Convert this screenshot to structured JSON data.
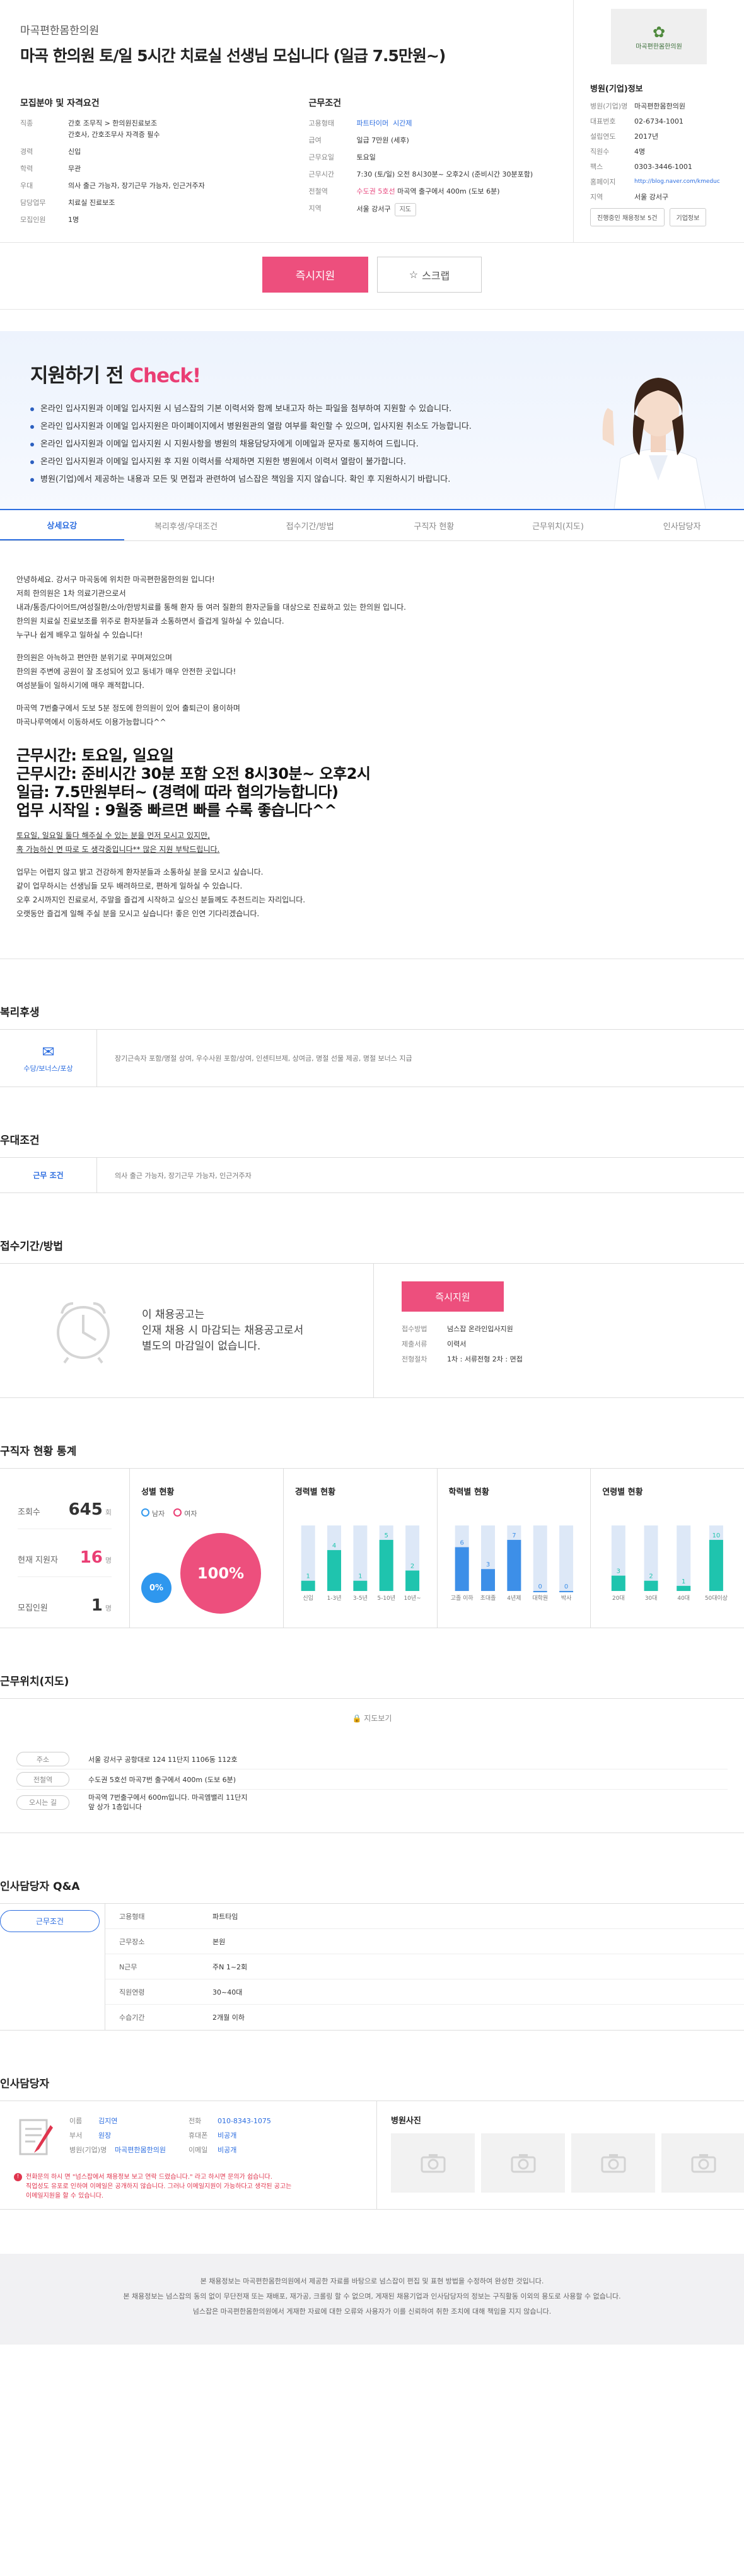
{
  "header": {
    "company": "마곡편한몸한의원",
    "title": "마곡 한의원 토/일 5시간 치료실 선생님 모십니다 (일급 7.5만원~)"
  },
  "recruit_info": {
    "heading": "모집분야 및 자격요건",
    "rows": [
      {
        "k": "직종",
        "v": "간호 조무직 > 한의원진료보조"
      },
      {
        "k": "",
        "v": "간호사, 간호조무사 자격증 필수"
      },
      {
        "k": "경력",
        "v": "신입"
      },
      {
        "k": "학력",
        "v": "무관"
      },
      {
        "k": "우대",
        "v": "의사 출근 가능자, 장기근무 가능자, 인근거주자"
      },
      {
        "k": "담당업무",
        "v": "치료실 진료보조"
      },
      {
        "k": "모집인원",
        "v": "1명"
      }
    ]
  },
  "work_info": {
    "heading": "근무조건",
    "rows": [
      {
        "k": "고용형태",
        "v1": "파트타이머",
        "v2": "시간제"
      },
      {
        "k": "급여",
        "v1": "일급 7만원 (세후)"
      },
      {
        "k": "근무요일",
        "v1": "토요일"
      },
      {
        "k": "근무시간",
        "v1": "7:30 (토/일) 오전 8시30분~ 오후2시 (준비시간 30분포함)"
      },
      {
        "k": "전철역",
        "v1": "수도권 5호선",
        "v2": "마곡역 출구에서 400m (도보 6분)"
      },
      {
        "k": "지역",
        "v1": "서울 강서구",
        "btn": "지도"
      }
    ]
  },
  "hospital": {
    "logo_text": "마곡편한몸한의원",
    "heading": "병원(기업)정보",
    "rows": [
      {
        "k": "병원(기업)명",
        "v": "마곡편한몸한의원"
      },
      {
        "k": "대표번호",
        "v": "02-6734-1001"
      },
      {
        "k": "설립연도",
        "v": "2017년"
      },
      {
        "k": "직원수",
        "v": "4명"
      },
      {
        "k": "팩스",
        "v": "0303-3446-1001"
      },
      {
        "k": "홈페이지",
        "v": "http://blog.naver.com/kmeduc"
      },
      {
        "k": "지역",
        "v": "서울 강서구"
      }
    ],
    "btn_jobs": "진행중인 채용정보 5건",
    "btn_info": "기업정보"
  },
  "actions": {
    "apply": "즉시지원",
    "scrap": "스크랩"
  },
  "check": {
    "title_a": "지원하기 전 ",
    "title_b": "Check!",
    "items": [
      "온라인 입사지원과 이메일 입사지원 시 넘스잡의 기본 이력서와 함께 보내고자 하는 파일을 첨부하여 지원할 수 있습니다.",
      "온라인 입사지원과 이메일 입사지원은 마이페이지에서 병원원관의 열람 여부를 확인할 수 있으며, 입사지원 취소도 가능합니다.",
      "온라인 입사지원과 이메일 입사지원 시 지원사항을 병원의 채용담당자에게 이메일과 문자로 통지하여 드립니다.",
      "온라인 입사지원과 이메일 입사지원 후 지원 이력서를 삭제하면 지원한 병원에서 이력서 열람이 불가합니다.",
      "병원(기업)에서 제공하는 내용과 모든 및 면접과 관련하여 넘스잡은 책임을 지지 않습니다. 확인 후 지원하시기 바랍니다."
    ]
  },
  "tabs": [
    "상세요강",
    "복리후생/우대조건",
    "접수기간/방법",
    "구직자 현황",
    "근무위치(지도)",
    "인사담당자"
  ],
  "detail": {
    "p1": [
      "안녕하세요. 강서구 마곡동에 위치한 마곡편한몸한의원 입니다!",
      "저희 한의원은 1차 의료기관으로서",
      "내과/통증/다이어트/여성질환/소아/한방치료를 통해 환자 등 여러 질환의 환자군들을 대상으로 진료하고 있는 한의원 입니다.",
      "한의원 치료실 진료보조를 위주로 환자분들과 소통하면서 즐겁게 일하실 수 있습니다.",
      "누구나 쉽게 배우고 일하실 수 있습니다!"
    ],
    "p2": [
      "한의원은 아늑하고 편안한 분위기로 꾸며져있으며",
      "한의원 주변에 공원이 잘 조성되어 있고 동네가 매우 안전한 곳입니다!",
      "여성분들이 일하시기에 매우 쾌적합니다."
    ],
    "p3": [
      "마곡역 7번출구에서 도보 5분 정도에 한의원이 있어 출퇴근이 용이하며",
      "마곡나루역에서 이동하셔도 이용가능합니다^^"
    ],
    "big": [
      "근무시간: 토요일, 일요일",
      "근무시간: 준비시간 30분 포함 오전 8시30분~ 오후2시",
      "일급: 7.5만원부터~ (경력에 따라 협의가능합니다)",
      "업무 시작일 : 9월중 빠르면 빠를 수록 좋습니다^^"
    ],
    "u": [
      "토요일, 일요일 둘다 해주실 수 있는 분을 먼저 모시고 있지만,",
      "혹 가능하신 면 따로 도 생각중입니다** 많은 지원 부탁드립니다."
    ],
    "p4": [
      "업무는 어렵지 않고 밝고 건강하게 환자분들과 소통하실 분을 모시고 싶습니다.",
      "같이 업무하시는 선생님들 모두 배려하므로, 편하게 일하실 수 있습니다.",
      "오후 2시까지인 진료로서, 주말을 즐겁게 시작하고 싶으신 분들께도 추천드리는 자리입니다.",
      "오랫동안 즐겁게 일해 주실 분을 모시고 싶습니다! 좋은 인연 기다리겠습니다."
    ]
  },
  "benefits": {
    "title": "복리후생",
    "label": "수당/보너스/포상",
    "text": "장기근속자 포함/명절 상여, 우수사원 포함/상여, 인센티브제, 상여금, 명절 선물 제공, 명절 보너스 지급"
  },
  "preference": {
    "title": "우대조건",
    "label": "근무 조건",
    "text": "의사 출근 가능자, 장기근무 가능자, 인근거주자"
  },
  "receive": {
    "title": "접수기간/방법",
    "msg1": "이 채용공고는",
    "msg2": "인재 채용 시 마감되는 채용공고로서",
    "msg3": "별도의 마감일이 없습니다.",
    "apply": "즉시지원",
    "rows": [
      {
        "k": "접수방법",
        "v": "넘스잡 온라인입사지원"
      },
      {
        "k": "제출서류",
        "v": "이력서"
      },
      {
        "k": "전형절차",
        "v": "1차 : 서류전형   2차 : 면접"
      }
    ]
  },
  "stats": {
    "title": "구직자 현황 통계",
    "left": [
      {
        "k": "조회수",
        "num": "645",
        "unit": "회"
      },
      {
        "k": "현재 지원자",
        "num": "16",
        "unit": "명"
      },
      {
        "k": "모집인원",
        "num": "1",
        "unit": "명"
      }
    ],
    "gender": {
      "title": "성별 현황",
      "male": "남자",
      "female": "여자",
      "male_pct": "0%",
      "female_pct": "100%"
    },
    "career": {
      "title": "경력별 현황",
      "cats": [
        "신입",
        "1-3년",
        "3-5년",
        "5-10년",
        "10년~"
      ],
      "values": [
        1,
        4,
        1,
        5,
        2
      ]
    },
    "edu": {
      "title": "학력별 현황",
      "cats": [
        "고졸 이하",
        "초대졸",
        "4년제",
        "대학원",
        "박사"
      ],
      "values": [
        6,
        3,
        7,
        0,
        0
      ]
    },
    "age": {
      "title": "연령별 현황",
      "cats": [
        "20대",
        "30대",
        "40대",
        "50대이상"
      ],
      "values": [
        3,
        2,
        1,
        10
      ]
    }
  },
  "location": {
    "title": "근무위치(지도)",
    "map_link": "지도보기",
    "rows": [
      {
        "k": "주소",
        "v": "서울 강서구 공항대로 124 11단지 1106동 112호"
      },
      {
        "k": "전철역",
        "v": "수도권 5호선 마곡7번 출구에서 400m (도보 6분)"
      },
      {
        "k": "오시는 길",
        "v": "마곡역 7번출구에서 600m입니다. 마곡엠밸리 11단지 앞 상가 1층입니다"
      }
    ]
  },
  "qna": {
    "title": "인사담당자 Q&A",
    "tab": "근무조건",
    "rows": [
      {
        "k": "고용형태",
        "v": "파트타임"
      },
      {
        "k": "근무장소",
        "v": "본원"
      },
      {
        "k": "N근무",
        "v": "주N 1~2회"
      },
      {
        "k": "직원연령",
        "v": "30~40대"
      },
      {
        "k": "수습기간",
        "v": "2개월 이하"
      }
    ]
  },
  "manager": {
    "title": "인사담당자",
    "left": [
      {
        "k": "이름",
        "v": "김지연"
      },
      {
        "k": "부서",
        "v": "원장"
      },
      {
        "k": "병원(기업)명",
        "v": "마곡편한몸한의원"
      }
    ],
    "right": [
      {
        "k": "전화",
        "v": "010-8343-1075"
      },
      {
        "k": "휴대폰",
        "v": "비공개"
      },
      {
        "k": "이메일",
        "v": "비공개"
      }
    ],
    "warn1": "전화문의 하시 면 \"넘스잡에서 채용정보 보고 연락 드렸습니다.\" 라고 하시면 문의가 쉽습니다.",
    "warn2": "직업성도 유포로 인하여 이메일은 공개하지 않습니다. 그러나 이메일지원이 가능하다고 생각된 공고는",
    "warn3": "이메일지원을 할 수 있습니다.",
    "photos_title": "병원사진"
  },
  "footer": {
    "l1": "본 채용정보는 마곡편한몸한의원에서 제공한 자료를 바탕으로 넘스잡이 편집 및 표현 방법을 수정하여 완성한 것입니다.",
    "l2": "본 채용정보는 넘스잡의 동의 없이 무단전재 또는 재배포, 재가공, 크롤링 할 수 없으며, 게재된 채용기업과 인사담당자의 정보는 구직활동 이외의 용도로 사용할 수 없습니다.",
    "l3": "넘스잡은 마곡편한몸한의원에서 게재한 자료에 대한 오류와 사용자가 이를 신뢰하여 취한 조치에 대해 책임을 지지 않습니다."
  },
  "colors": {
    "accent": "#2d6ee0",
    "pink": "#ed4f7d",
    "teal": "#1fc4ae",
    "bar_bg": "#dde8f7"
  }
}
